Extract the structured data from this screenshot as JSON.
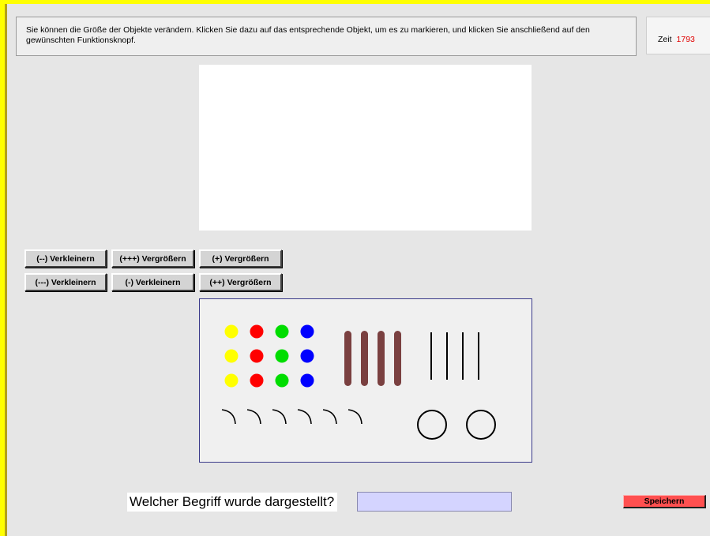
{
  "instructions": {
    "text": "Sie können die Größe der Objekte verändern. Klicken Sie dazu auf das entsprechende Objekt, um es zu markieren, und klicken Sie anschließend auf den gewünschten Funktionsknopf."
  },
  "timer": {
    "label": "Zeit",
    "value": "1793"
  },
  "buttons": {
    "shrink2": "(--) Verkleinern",
    "grow3": "(+++) Vergrößern",
    "grow1": "(+) Vergrößern",
    "shrink3": "(---) Verkleinern",
    "shrink1": "(-) Verkleinern",
    "grow2": "(++) Vergrößern"
  },
  "panel": {
    "dot_colors": [
      "#ffff00",
      "#ff0000",
      "#00dd00",
      "#0000ff"
    ],
    "bar_color": "#7a4040",
    "line_color": "#000000",
    "dot_rows": 3,
    "bar_count": 4,
    "line_count": 4,
    "arc_count": 6,
    "circle_count": 2
  },
  "question": {
    "label": "Welcher Begriff wurde dargestellt?",
    "answer_value": ""
  },
  "save_label": "Speichern",
  "colors": {
    "frame_yellow": "#ffff00",
    "save_red": "#ff5050",
    "answer_bg": "#d4d4ff",
    "timer_value": "#e00000"
  }
}
